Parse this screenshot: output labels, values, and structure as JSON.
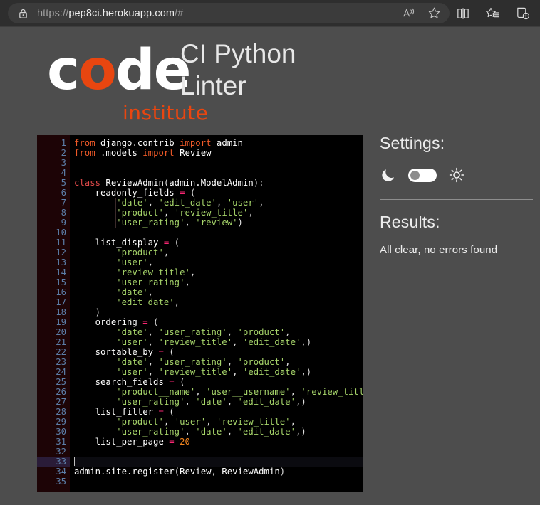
{
  "browser": {
    "url_prefix": "https://",
    "url_host": "pep8ci.herokuapp.com",
    "url_suffix": "/#",
    "lock_icon": "lock-icon",
    "read_aloud_icon": "read-aloud-icon",
    "favorite_icon": "star-outline-icon",
    "split_screen_icon": "split-screen-icon",
    "favorites_list_icon": "favorites-star-list-icon",
    "collections_icon": "collections-add-icon"
  },
  "header": {
    "logo_c": "c",
    "logo_o": "o",
    "logo_de": "de",
    "logo_institute": "institute",
    "title": "CI Python\nLinter"
  },
  "editor": {
    "total_lines": 35,
    "active_line": 33,
    "fold_line": 5,
    "lines": [
      {
        "n": 1,
        "tokens": [
          {
            "t": "from",
            "c": "k"
          },
          {
            "t": " django.contrib ",
            "c": "n"
          },
          {
            "t": "import",
            "c": "k"
          },
          {
            "t": " admin",
            "c": "n"
          }
        ]
      },
      {
        "n": 2,
        "tokens": [
          {
            "t": "from",
            "c": "k"
          },
          {
            "t": " .models ",
            "c": "n"
          },
          {
            "t": "import",
            "c": "k"
          },
          {
            "t": " Review",
            "c": "n"
          }
        ]
      },
      {
        "n": 3,
        "tokens": []
      },
      {
        "n": 4,
        "tokens": []
      },
      {
        "n": 5,
        "tokens": [
          {
            "t": "class",
            "c": "kc"
          },
          {
            "t": " ReviewAdmin",
            "c": "n"
          },
          {
            "t": "(",
            "c": "p"
          },
          {
            "t": "admin.ModelAdmin",
            "c": "n"
          },
          {
            "t": "):",
            "c": "p"
          }
        ]
      },
      {
        "n": 6,
        "tokens": [
          {
            "t": "    readonly_fields ",
            "c": "n"
          },
          {
            "t": "=",
            "c": "op"
          },
          {
            "t": " (",
            "c": "p"
          }
        ]
      },
      {
        "n": 7,
        "tokens": [
          {
            "t": "        ",
            "c": "n"
          },
          {
            "t": "'date'",
            "c": "s"
          },
          {
            "t": ", ",
            "c": "p"
          },
          {
            "t": "'edit_date'",
            "c": "s"
          },
          {
            "t": ", ",
            "c": "p"
          },
          {
            "t": "'user'",
            "c": "s"
          },
          {
            "t": ",",
            "c": "p"
          }
        ]
      },
      {
        "n": 8,
        "tokens": [
          {
            "t": "        ",
            "c": "n"
          },
          {
            "t": "'product'",
            "c": "s"
          },
          {
            "t": ", ",
            "c": "p"
          },
          {
            "t": "'review_title'",
            "c": "s"
          },
          {
            "t": ",",
            "c": "p"
          }
        ]
      },
      {
        "n": 9,
        "tokens": [
          {
            "t": "        ",
            "c": "n"
          },
          {
            "t": "'user_rating'",
            "c": "s"
          },
          {
            "t": ", ",
            "c": "p"
          },
          {
            "t": "'review'",
            "c": "s"
          },
          {
            "t": ")",
            "c": "p"
          }
        ]
      },
      {
        "n": 10,
        "tokens": []
      },
      {
        "n": 11,
        "tokens": [
          {
            "t": "    list_display ",
            "c": "n"
          },
          {
            "t": "=",
            "c": "op"
          },
          {
            "t": " (",
            "c": "p"
          }
        ]
      },
      {
        "n": 12,
        "tokens": [
          {
            "t": "        ",
            "c": "n"
          },
          {
            "t": "'product'",
            "c": "s"
          },
          {
            "t": ",",
            "c": "p"
          }
        ]
      },
      {
        "n": 13,
        "tokens": [
          {
            "t": "        ",
            "c": "n"
          },
          {
            "t": "'user'",
            "c": "s"
          },
          {
            "t": ",",
            "c": "p"
          }
        ]
      },
      {
        "n": 14,
        "tokens": [
          {
            "t": "        ",
            "c": "n"
          },
          {
            "t": "'review_title'",
            "c": "s"
          },
          {
            "t": ",",
            "c": "p"
          }
        ]
      },
      {
        "n": 15,
        "tokens": [
          {
            "t": "        ",
            "c": "n"
          },
          {
            "t": "'user_rating'",
            "c": "s"
          },
          {
            "t": ",",
            "c": "p"
          }
        ]
      },
      {
        "n": 16,
        "tokens": [
          {
            "t": "        ",
            "c": "n"
          },
          {
            "t": "'date'",
            "c": "s"
          },
          {
            "t": ",",
            "c": "p"
          }
        ]
      },
      {
        "n": 17,
        "tokens": [
          {
            "t": "        ",
            "c": "n"
          },
          {
            "t": "'edit_date'",
            "c": "s"
          },
          {
            "t": ",",
            "c": "p"
          }
        ]
      },
      {
        "n": 18,
        "tokens": [
          {
            "t": "    )",
            "c": "p"
          }
        ]
      },
      {
        "n": 19,
        "tokens": [
          {
            "t": "    ordering ",
            "c": "n"
          },
          {
            "t": "=",
            "c": "op"
          },
          {
            "t": " (",
            "c": "p"
          }
        ]
      },
      {
        "n": 20,
        "tokens": [
          {
            "t": "        ",
            "c": "n"
          },
          {
            "t": "'date'",
            "c": "s"
          },
          {
            "t": ", ",
            "c": "p"
          },
          {
            "t": "'user_rating'",
            "c": "s"
          },
          {
            "t": ", ",
            "c": "p"
          },
          {
            "t": "'product'",
            "c": "s"
          },
          {
            "t": ",",
            "c": "p"
          }
        ]
      },
      {
        "n": 21,
        "tokens": [
          {
            "t": "        ",
            "c": "n"
          },
          {
            "t": "'user'",
            "c": "s"
          },
          {
            "t": ", ",
            "c": "p"
          },
          {
            "t": "'review_title'",
            "c": "s"
          },
          {
            "t": ", ",
            "c": "p"
          },
          {
            "t": "'edit_date'",
            "c": "s"
          },
          {
            "t": ",)",
            "c": "p"
          }
        ]
      },
      {
        "n": 22,
        "tokens": [
          {
            "t": "    sortable_by ",
            "c": "n"
          },
          {
            "t": "=",
            "c": "op"
          },
          {
            "t": " (",
            "c": "p"
          }
        ]
      },
      {
        "n": 23,
        "tokens": [
          {
            "t": "        ",
            "c": "n"
          },
          {
            "t": "'date'",
            "c": "s"
          },
          {
            "t": ", ",
            "c": "p"
          },
          {
            "t": "'user_rating'",
            "c": "s"
          },
          {
            "t": ", ",
            "c": "p"
          },
          {
            "t": "'product'",
            "c": "s"
          },
          {
            "t": ",",
            "c": "p"
          }
        ]
      },
      {
        "n": 24,
        "tokens": [
          {
            "t": "        ",
            "c": "n"
          },
          {
            "t": "'user'",
            "c": "s"
          },
          {
            "t": ", ",
            "c": "p"
          },
          {
            "t": "'review_title'",
            "c": "s"
          },
          {
            "t": ", ",
            "c": "p"
          },
          {
            "t": "'edit_date'",
            "c": "s"
          },
          {
            "t": ",)",
            "c": "p"
          }
        ]
      },
      {
        "n": 25,
        "tokens": [
          {
            "t": "    search_fields ",
            "c": "n"
          },
          {
            "t": "=",
            "c": "op"
          },
          {
            "t": " (",
            "c": "p"
          }
        ]
      },
      {
        "n": 26,
        "tokens": [
          {
            "t": "        ",
            "c": "n"
          },
          {
            "t": "'product__name'",
            "c": "s"
          },
          {
            "t": ", ",
            "c": "p"
          },
          {
            "t": "'user__username'",
            "c": "s"
          },
          {
            "t": ", ",
            "c": "p"
          },
          {
            "t": "'review_title'",
            "c": "s"
          },
          {
            "t": ",",
            "c": "p"
          }
        ]
      },
      {
        "n": 27,
        "tokens": [
          {
            "t": "        ",
            "c": "n"
          },
          {
            "t": "'user_rating'",
            "c": "s"
          },
          {
            "t": ", ",
            "c": "p"
          },
          {
            "t": "'date'",
            "c": "s"
          },
          {
            "t": ", ",
            "c": "p"
          },
          {
            "t": "'edit_date'",
            "c": "s"
          },
          {
            "t": ",)",
            "c": "p"
          }
        ]
      },
      {
        "n": 28,
        "tokens": [
          {
            "t": "    list_filter ",
            "c": "n"
          },
          {
            "t": "=",
            "c": "op"
          },
          {
            "t": " (",
            "c": "p"
          }
        ]
      },
      {
        "n": 29,
        "tokens": [
          {
            "t": "        ",
            "c": "n"
          },
          {
            "t": "'product'",
            "c": "s"
          },
          {
            "t": ", ",
            "c": "p"
          },
          {
            "t": "'user'",
            "c": "s"
          },
          {
            "t": ", ",
            "c": "p"
          },
          {
            "t": "'review_title'",
            "c": "s"
          },
          {
            "t": ",",
            "c": "p"
          }
        ]
      },
      {
        "n": 30,
        "tokens": [
          {
            "t": "        ",
            "c": "n"
          },
          {
            "t": "'user_rating'",
            "c": "s"
          },
          {
            "t": ", ",
            "c": "p"
          },
          {
            "t": "'date'",
            "c": "s"
          },
          {
            "t": ", ",
            "c": "p"
          },
          {
            "t": "'edit_date'",
            "c": "s"
          },
          {
            "t": ",)",
            "c": "p"
          }
        ]
      },
      {
        "n": 31,
        "tokens": [
          {
            "t": "    list_per_page ",
            "c": "n"
          },
          {
            "t": "=",
            "c": "op"
          },
          {
            "t": " ",
            "c": "p"
          },
          {
            "t": "20",
            "c": "num"
          }
        ]
      },
      {
        "n": 32,
        "tokens": []
      },
      {
        "n": 33,
        "tokens": []
      },
      {
        "n": 34,
        "tokens": [
          {
            "t": "admin.site.register",
            "c": "n"
          },
          {
            "t": "(",
            "c": "p"
          },
          {
            "t": "Review",
            "c": "n"
          },
          {
            "t": ", ",
            "c": "p"
          },
          {
            "t": "ReviewAdmin",
            "c": "n"
          },
          {
            "t": ")",
            "c": "p"
          }
        ]
      },
      {
        "n": 35,
        "tokens": []
      }
    ]
  },
  "panel": {
    "settings_heading": "Settings:",
    "moon_icon": "moon-icon",
    "sun_icon": "sun-icon",
    "theme_toggle": "theme-toggle-switch",
    "theme_state": "dark",
    "results_heading": "Results:",
    "results_text": "All clear, no errors found"
  },
  "colors": {
    "page_background": "#4d4d4d",
    "editor_background": "#000000",
    "gutter_background": "#1d0406",
    "brand_orange": "#e84610",
    "keyword": "#f05a28",
    "string": "#a6d46a",
    "operator": "#f92672",
    "number": "#f5871f",
    "line_number": "#5c7ea8",
    "active_line": "#2a1c38"
  }
}
